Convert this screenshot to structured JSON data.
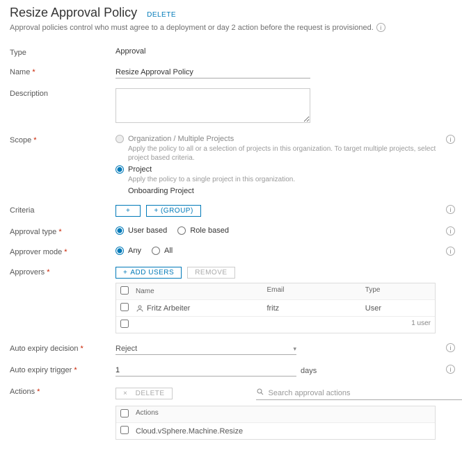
{
  "header": {
    "title": "Resize Approval Policy",
    "delete": "DELETE"
  },
  "subtitle": "Approval policies control who must agree to a deployment or day 2 action before the request is provisioned.",
  "labels": {
    "type": "Type",
    "name": "Name",
    "description": "Description",
    "scope": "Scope",
    "criteria": "Criteria",
    "approval_type": "Approval type",
    "approver_mode": "Approver mode",
    "approvers": "Approvers",
    "auto_expiry_decision": "Auto expiry decision",
    "auto_expiry_trigger": "Auto expiry trigger",
    "actions": "Actions"
  },
  "values": {
    "type": "Approval",
    "name": "Resize Approval Policy",
    "description": "",
    "auto_expiry_decision": "Reject",
    "auto_expiry_trigger": "1",
    "days_suffix": "days"
  },
  "scope": {
    "opt1": {
      "label": "Organization / Multiple Projects",
      "hint": "Apply the policy to all or a selection of projects in this organization. To target multiple projects, select project based criteria."
    },
    "opt2": {
      "label": "Project",
      "hint": "Apply the policy to a single project in this organization."
    },
    "project_name": "Onboarding Project"
  },
  "criteria": {
    "plus": "+",
    "group_btn": "+ (GROUP)"
  },
  "approval_type": {
    "user": "User based",
    "role": "Role based"
  },
  "approver_mode": {
    "any": "Any",
    "all": "All"
  },
  "approvers": {
    "add_btn": "ADD USERS",
    "remove_btn": "REMOVE",
    "cols": {
      "name": "Name",
      "email": "Email",
      "type": "Type"
    },
    "row": {
      "name": "Fritz Arbeiter",
      "email": "fritz",
      "type": "User"
    },
    "count": "1 user"
  },
  "actions": {
    "delete_btn": "DELETE",
    "search_placeholder": "Search approval actions",
    "col": "Actions",
    "row": "Cloud.vSphere.Machine.Resize"
  }
}
